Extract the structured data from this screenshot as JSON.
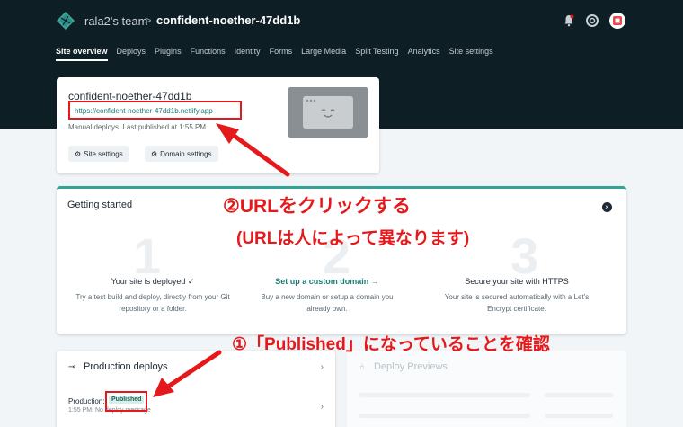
{
  "header": {
    "team": "rala2's team",
    "separator": ">",
    "site_name": "confident-noether-47dd1b"
  },
  "nav": {
    "items": [
      "Site overview",
      "Deploys",
      "Plugins",
      "Functions",
      "Identity",
      "Forms",
      "Large Media",
      "Split Testing",
      "Analytics",
      "Site settings"
    ]
  },
  "site_card": {
    "title": "confident-noether-47dd1b",
    "url": "https://confident-noether-47dd1b.netlify.app",
    "meta": "Manual deploys. Last published at 1:55 PM.",
    "site_settings_btn": "Site settings",
    "domain_settings_btn": "Domain settings"
  },
  "getting_started": {
    "title": "Getting started",
    "steps": [
      {
        "num": "1",
        "title": "Your site is deployed ✓",
        "desc1": "Try a test build and deploy, directly from your Git",
        "desc2": "repository or a folder."
      },
      {
        "num": "2",
        "title": "Set up a custom domain →",
        "desc1": "Buy a new domain or setup a domain you",
        "desc2": "already own."
      },
      {
        "num": "3",
        "title": "Secure your site with HTTPS",
        "desc1": "Your site is secured automatically with a Let's",
        "desc2": "Encrypt certificate."
      }
    ]
  },
  "production_deploys": {
    "title": "Production deploys",
    "row_label": "Production:",
    "badge": "Published",
    "row_sub": "1:55 PM: No deploy message"
  },
  "deploy_previews": {
    "title": "Deploy Previews"
  },
  "annotations": {
    "url_instruction_line1": "②URLをクリックする",
    "url_instruction_line2": "(URLは人によって異なります)",
    "published_instruction": "①「Published」になっていることを確認"
  },
  "colors": {
    "accent": "#33a397",
    "annotation": "#e5191b",
    "header_bg": "#0e1e25"
  }
}
